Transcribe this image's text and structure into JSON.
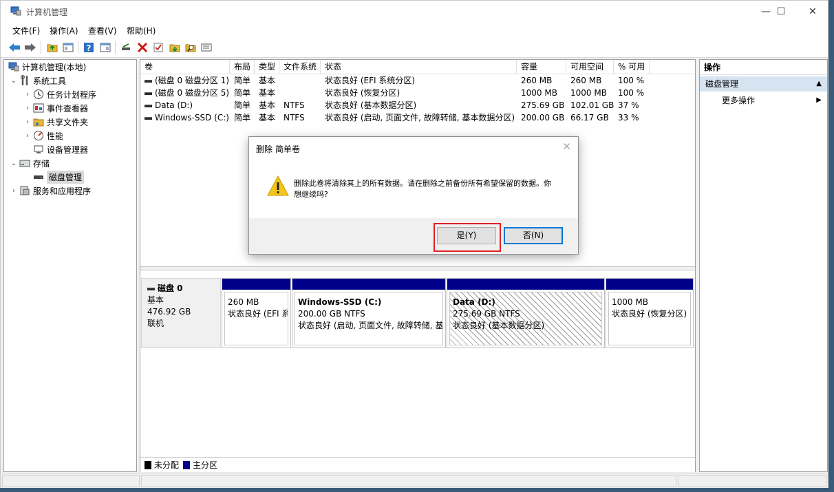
{
  "window": {
    "title": "计算机管理",
    "min_label": "—",
    "max_label": "☐",
    "close_label": "✕"
  },
  "menu": [
    "文件(F)",
    "操作(A)",
    "查看(V)",
    "帮助(H)"
  ],
  "toolbar": {
    "icons": [
      "back-arrow-icon",
      "forward-arrow-icon",
      "up-folder-icon",
      "show-hide-tree-icon",
      "help-icon",
      "properties-icon",
      "connect-disk-icon",
      "delete-icon",
      "check-icon",
      "import-icon",
      "search-icon",
      "list-view-icon"
    ]
  },
  "tree": {
    "root": "计算机管理(本地)",
    "system_tools": "系统工具",
    "task_scheduler": "任务计划程序",
    "event_viewer": "事件查看器",
    "shared_folders": "共享文件夹",
    "performance": "性能",
    "device_manager": "设备管理器",
    "storage": "存储",
    "disk_management": "磁盘管理",
    "services": "服务和应用程序"
  },
  "volumes": {
    "columns": [
      "卷",
      "布局",
      "类型",
      "文件系统",
      "状态",
      "容量",
      "可用空间",
      "% 可用"
    ],
    "rows": [
      [
        "(磁盘 0 磁盘分区 1)",
        "简单",
        "基本",
        "",
        "状态良好 (EFI 系统分区)",
        "260 MB",
        "260 MB",
        "100 %"
      ],
      [
        "(磁盘 0 磁盘分区 5)",
        "简单",
        "基本",
        "",
        "状态良好 (恢复分区)",
        "1000 MB",
        "1000 MB",
        "100 %"
      ],
      [
        "Data (D:)",
        "简单",
        "基本",
        "NTFS",
        "状态良好 (基本数据分区)",
        "275.69 GB",
        "102.01 GB",
        "37 %"
      ],
      [
        "Windows-SSD (C:)",
        "简单",
        "基本",
        "NTFS",
        "状态良好 (启动, 页面文件, 故障转储, 基本数据分区)",
        "200.00 GB",
        "66.17 GB",
        "33 %"
      ]
    ]
  },
  "disk": {
    "name": "磁盘 0",
    "type": "基本",
    "size": "476.92 GB",
    "status": "联机",
    "partitions": [
      {
        "name": "",
        "size": "260 MB",
        "status": "状态良好 (EFI 系统分区)"
      },
      {
        "name": "Windows-SSD  (C:)",
        "size": "200.00 GB NTFS",
        "status": "状态良好 (启动, 页面文件, 故障转储, 基本数据分区)"
      },
      {
        "name": "Data  (D:)",
        "size": "275.69 GB NTFS",
        "status": "状态良好 (基本数据分区)"
      },
      {
        "name": "",
        "size": "1000 MB",
        "status": "状态良好 (恢复分区)"
      }
    ]
  },
  "legend": {
    "unallocated": "未分配",
    "primary": "主分区",
    "unallocated_color": "#000000",
    "primary_color": "#00008b"
  },
  "actions": {
    "header": "操作",
    "section": "磁盘管理",
    "more": "更多操作"
  },
  "dialog": {
    "title": "删除 简单卷",
    "close": "✕",
    "message": "删除此卷将清除其上的所有数据。请在删除之前备份所有希望保留的数据。你想继续吗?",
    "yes": "是(Y)",
    "no": "否(N)"
  },
  "colors": {
    "highlight": "#e02020",
    "accent": "#0078d7",
    "selection": "#d6e3f0"
  }
}
